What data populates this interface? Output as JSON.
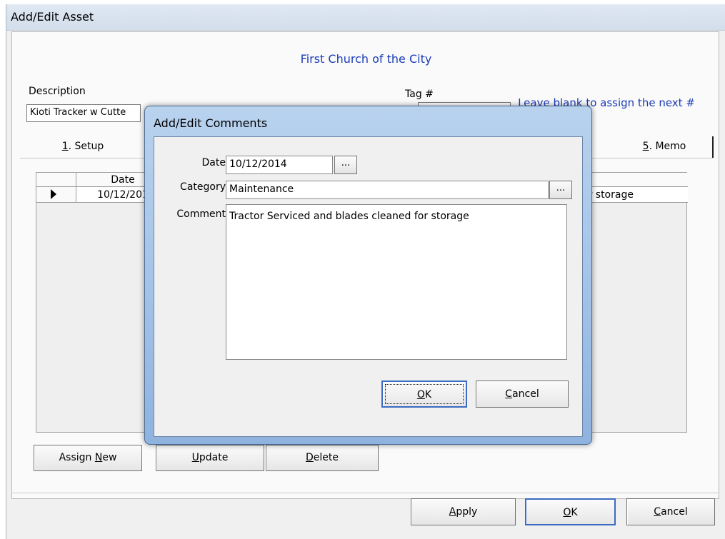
{
  "window": {
    "title": "Add/Edit Asset",
    "church_name": "First Church of the City"
  },
  "form": {
    "description_label": "Description",
    "description_value": "Kioti Tracker w Cutte",
    "tag_label": "Tag #",
    "tag_hint": "Leave blank to assign the next #"
  },
  "tabs": {
    "setup": {
      "mnemonic": "1",
      "label": ". Setup"
    },
    "memo": {
      "mnemonic": "5",
      "label": ". Memo"
    }
  },
  "grid": {
    "header_date": "Date",
    "row": {
      "date": "10/12/201",
      "comment": "or storage"
    }
  },
  "buttons": {
    "assign_new_pre": "Assign ",
    "assign_new_mn": "N",
    "assign_new_post": "ew",
    "update_mn": "U",
    "update_post": "pdate",
    "delete_mn": "D",
    "delete_post": "elete",
    "apply_mn": "A",
    "apply_post": "pply",
    "ok_mn": "O",
    "ok_post": "K",
    "cancel_mn": "C",
    "cancel_post": "ancel"
  },
  "modal": {
    "title": "Add/Edit Comments",
    "date_label": "Date",
    "date_value": "10/12/2014",
    "category_label": "Category",
    "category_value": "Maintenance",
    "comment_label": "Comment",
    "comment_value": "Tractor Serviced and blades cleaned for storage",
    "picker_label": "...",
    "ok_mn": "O",
    "ok_post": "K",
    "cancel_mn": "C",
    "cancel_post": "ancel"
  }
}
